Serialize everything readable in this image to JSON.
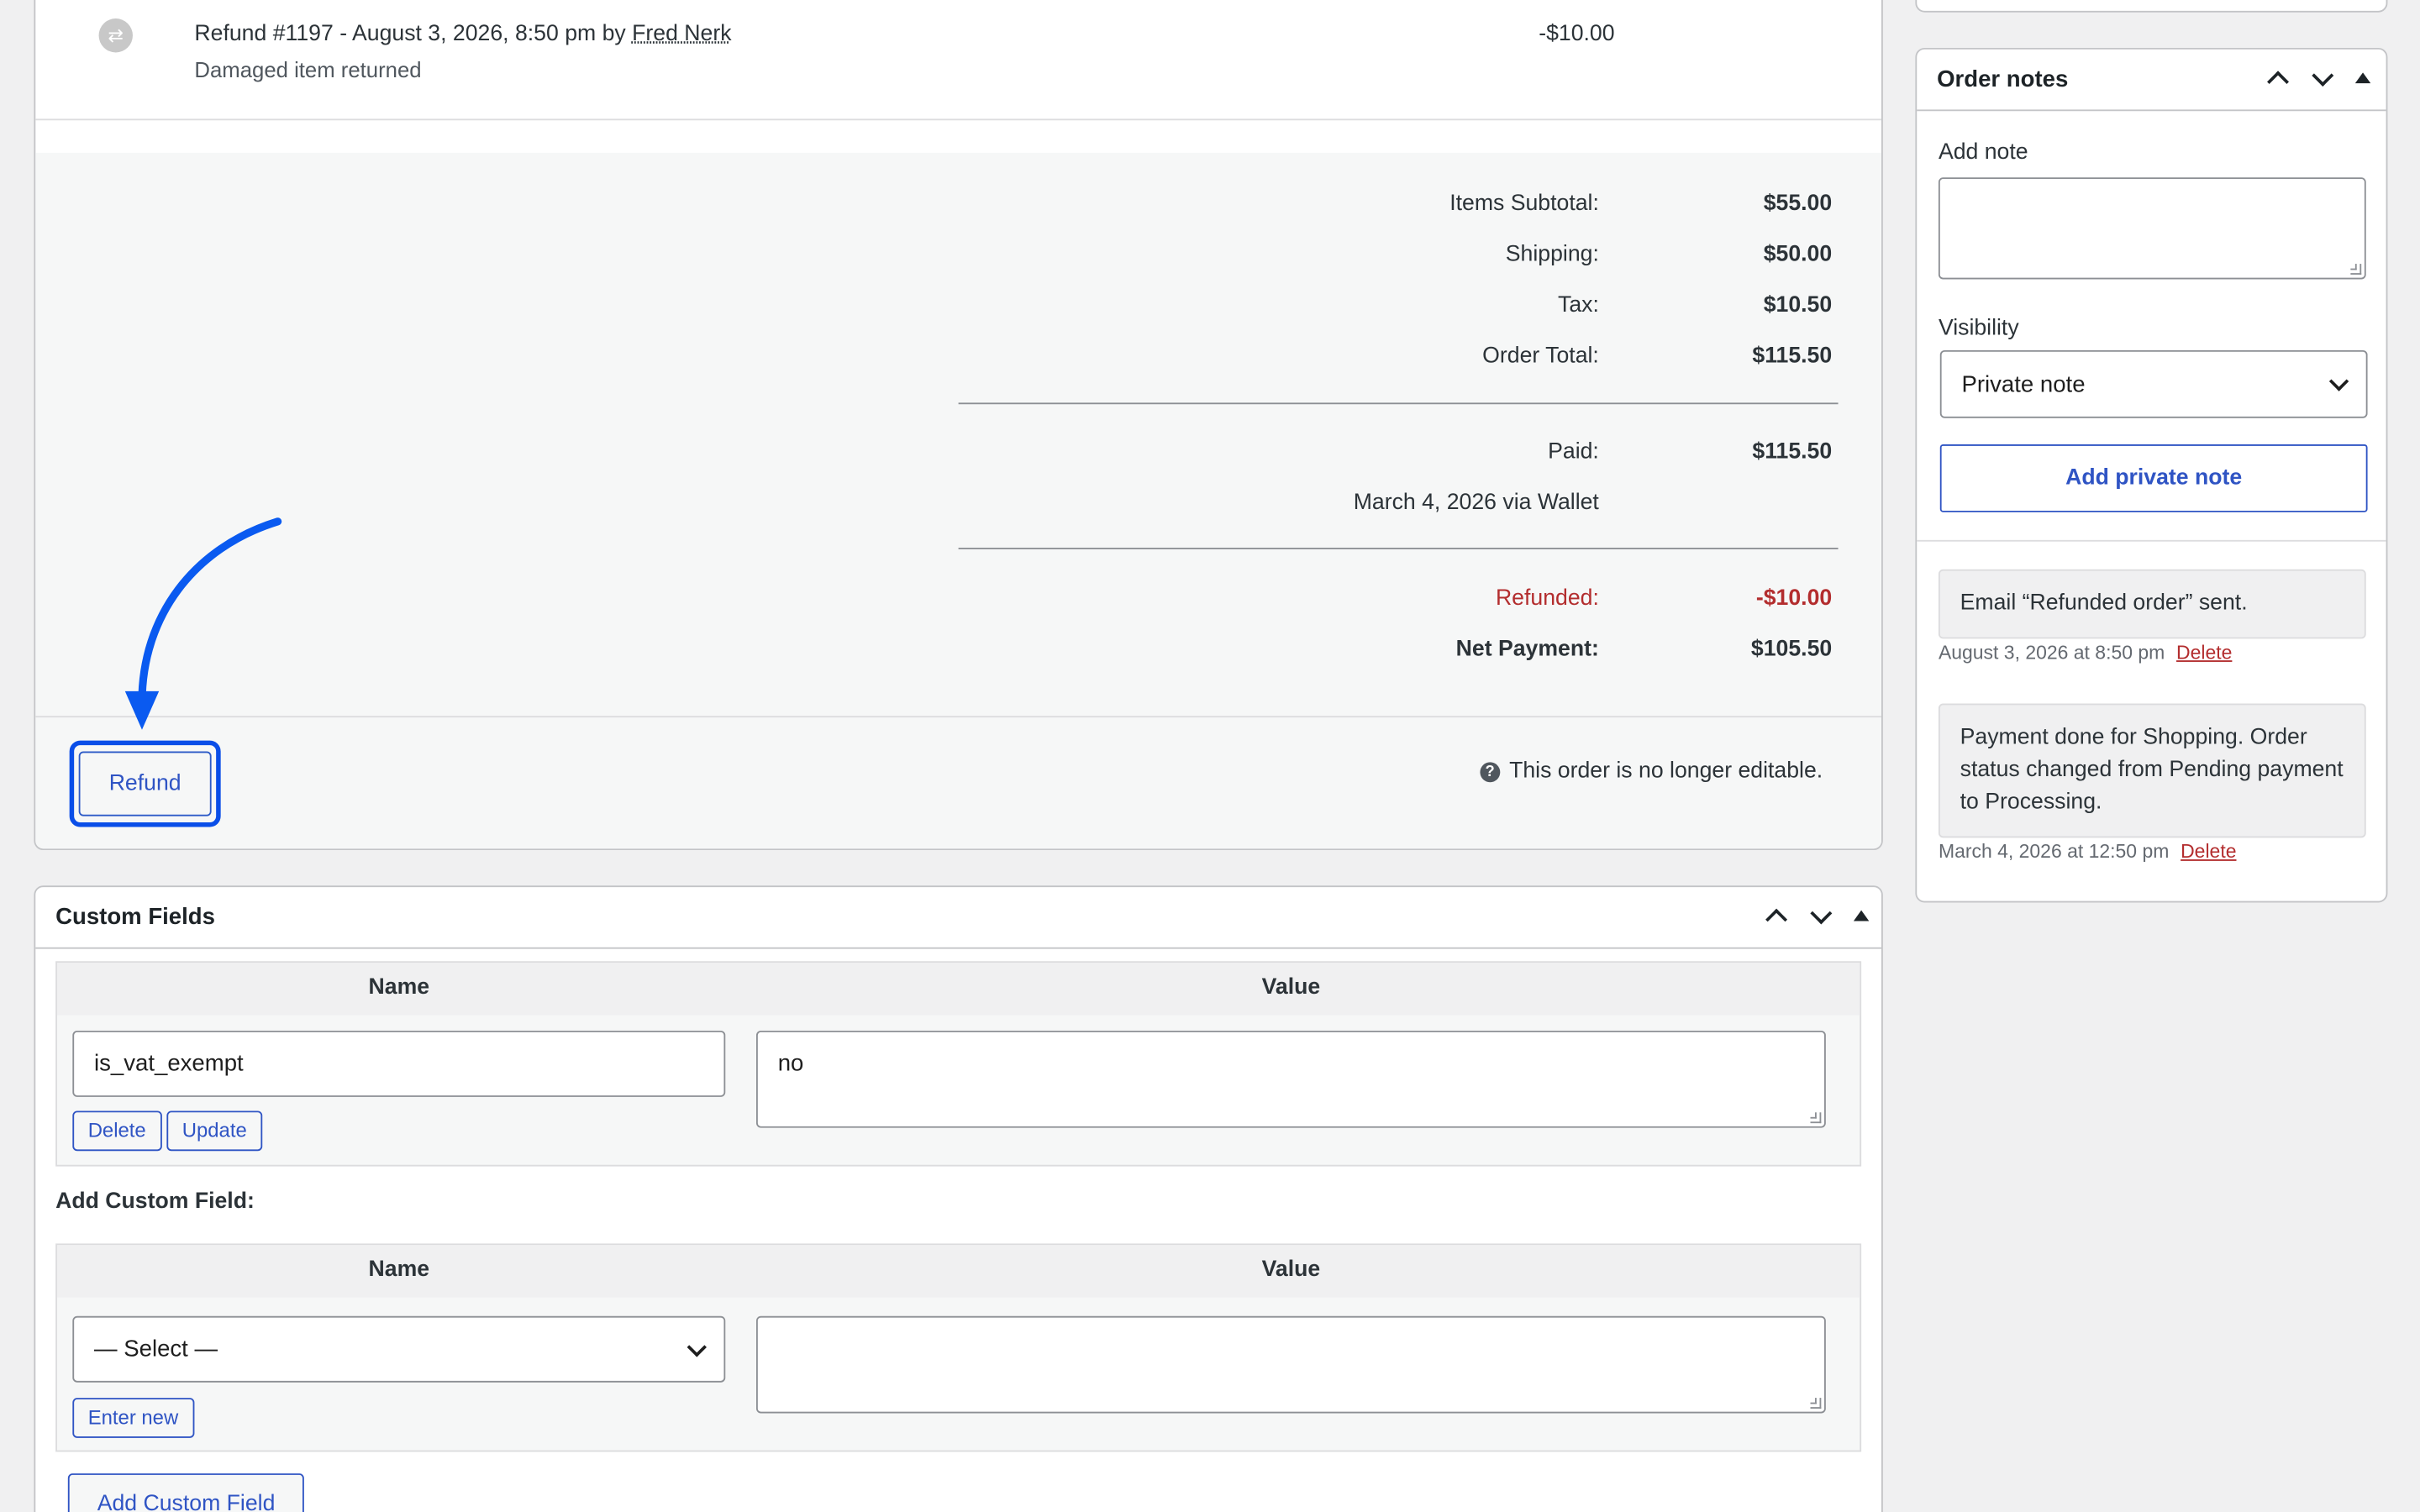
{
  "refund_row": {
    "title_prefix": "Refund #1197 - August 3, 2026, 8:50 pm by",
    "user": "Fred Nerk",
    "reason": "Damaged item returned",
    "amount": "-$10.00"
  },
  "totals": {
    "items_subtotal_label": "Items Subtotal:",
    "items_subtotal_value": "$55.00",
    "shipping_label": "Shipping:",
    "shipping_value": "$50.00",
    "tax_label": "Tax:",
    "tax_value": "$10.50",
    "order_total_label": "Order Total:",
    "order_total_value": "$115.50",
    "paid_label": "Paid:",
    "paid_value": "$115.50",
    "paid_via": "March 4, 2026 via Wallet",
    "refunded_label": "Refunded:",
    "refunded_value": "-$10.00",
    "net_label": "Net Payment:",
    "net_value": "$105.50"
  },
  "actions": {
    "refund_button": "Refund",
    "not_editable": "This order is no longer editable.",
    "help_glyph": "?"
  },
  "custom_fields": {
    "title": "Custom Fields",
    "col_name": "Name",
    "col_value": "Value",
    "existing": {
      "name": "is_vat_exempt",
      "value": "no",
      "delete_label": "Delete",
      "update_label": "Update"
    },
    "add_label": "Add Custom Field:",
    "new": {
      "select_value": "— Select —",
      "enter_new_label": "Enter new"
    },
    "add_button": "Add Custom Field"
  },
  "order_notes": {
    "title": "Order notes",
    "add_note_label": "Add note",
    "visibility_label": "Visibility",
    "visibility_value": "Private note",
    "add_button": "Add private note",
    "notes": [
      {
        "text": "Email “Refunded order” sent.",
        "meta": "August 3, 2026 at 8:50 pm",
        "delete_label": "Delete"
      },
      {
        "text": "Payment done for Shopping. Order status changed from Pending payment to Processing.",
        "meta": "March 4, 2026 at 12:50 pm",
        "delete_label": "Delete"
      }
    ]
  },
  "colors": {
    "annotation_arrow": "#0a5af0",
    "link_blue": "#2f54c4",
    "danger_red": "#b32d2e"
  }
}
